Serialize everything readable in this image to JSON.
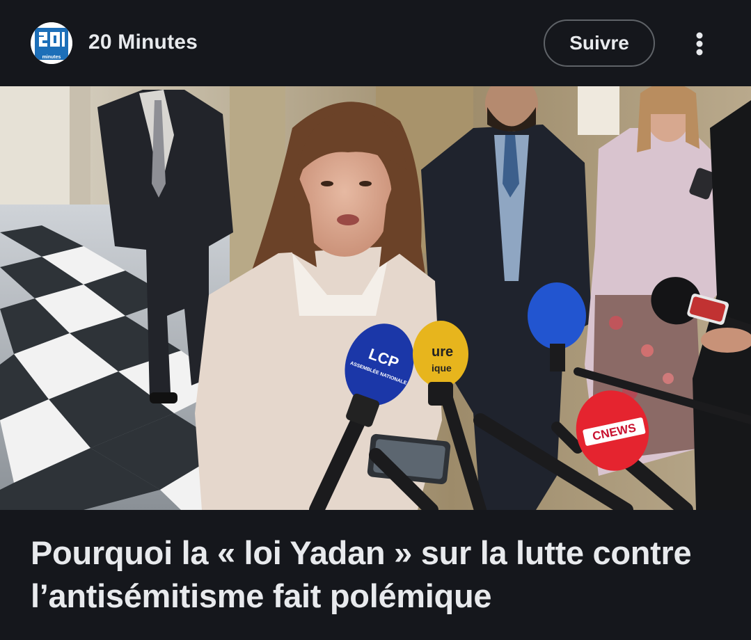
{
  "source": {
    "name": "20 Minutes",
    "logo_icon": "20-minutes-logo",
    "logo_text": "minutes"
  },
  "header": {
    "follow_label": "Suivre",
    "more_icon": "more-vert-icon"
  },
  "article": {
    "headline": "Pourquoi la « loi Yadan » sur la lutte contre l’antisémitisme fait polémique",
    "image_icon": "press-conference-photo",
    "microphone_labels": [
      "LCP",
      "ASSEMBLÉE NATIONALE",
      "ure",
      "ique",
      "CNEWS"
    ]
  },
  "colors": {
    "background": "#15171c",
    "text": "#e8eaed",
    "button_border": "#5f6368",
    "logo_blue": "#1d6fb8"
  }
}
